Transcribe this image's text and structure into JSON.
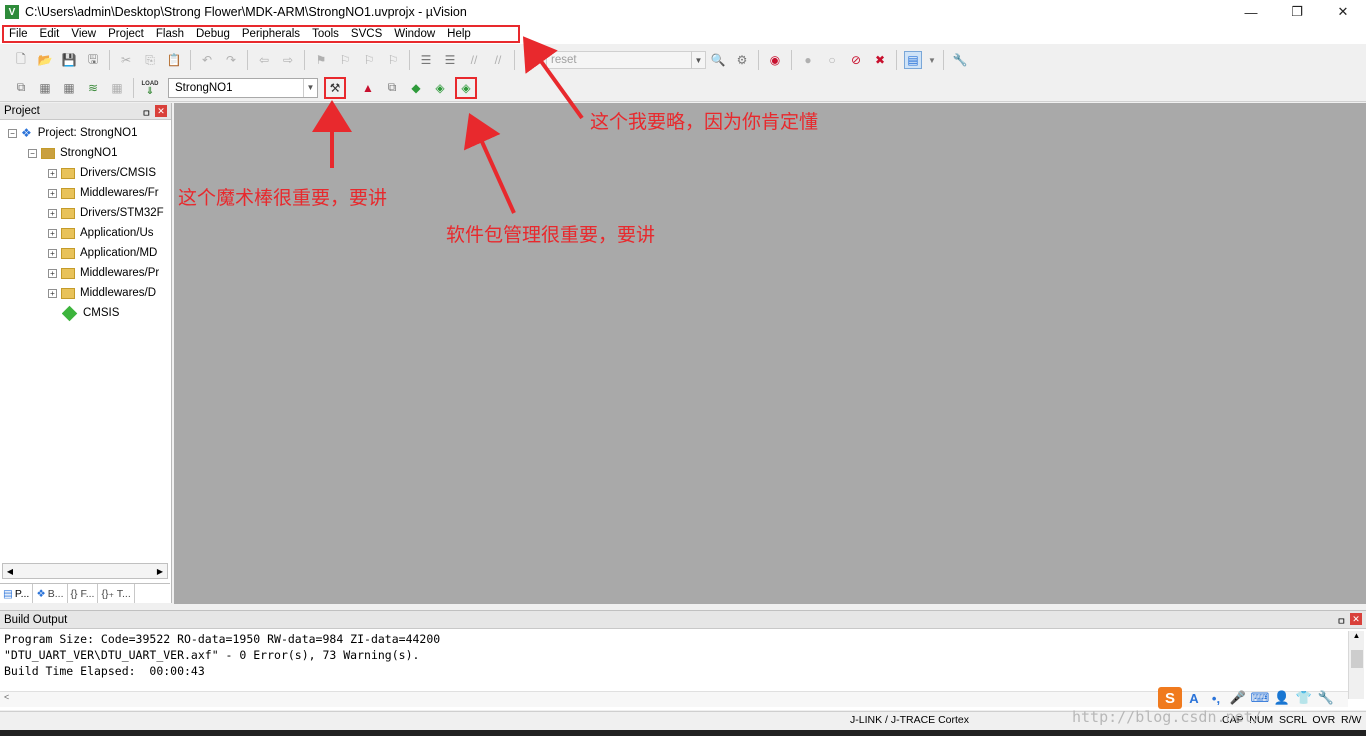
{
  "window": {
    "title": "C:\\Users\\admin\\Desktop\\Strong Flower\\MDK-ARM\\StrongNO1.uvprojx - µVision",
    "app_icon_glyph": "V",
    "minimize": "—",
    "maximize": "❐",
    "close": "✕"
  },
  "menu": [
    "File",
    "Edit",
    "View",
    "Project",
    "Flash",
    "Debug",
    "Peripherals",
    "Tools",
    "SVCS",
    "Window",
    "Help"
  ],
  "toolbar": {
    "find_combo_value": "reset",
    "target_combo_value": "StrongNO1",
    "load_label": "LOAD"
  },
  "project_panel": {
    "title": "Project",
    "pin": "ㅁ",
    "close": "✕",
    "tree": [
      {
        "label": "Project: StrongNO1",
        "kind": "root"
      },
      {
        "label": "StrongNO1",
        "kind": "target"
      },
      {
        "label": "Drivers/CMSIS",
        "kind": "folder"
      },
      {
        "label": "Middlewares/Fr",
        "kind": "folder"
      },
      {
        "label": "Drivers/STM32F",
        "kind": "folder"
      },
      {
        "label": "Application/Us",
        "kind": "folder"
      },
      {
        "label": "Application/MD",
        "kind": "folder"
      },
      {
        "label": "Middlewares/Pr",
        "kind": "folder"
      },
      {
        "label": "Middlewares/D",
        "kind": "folder"
      },
      {
        "label": "CMSIS",
        "kind": "component"
      }
    ],
    "tabs": [
      "P...",
      "B...",
      "{} F...",
      "{}₊ T..."
    ]
  },
  "build_output": {
    "title": "Build Output",
    "lines": [
      "Program Size: Code=39522 RO-data=1950 RW-data=984 ZI-data=44200",
      "\"DTU_UART_VER\\DTU_UART_VER.axf\" - 0 Error(s), 73 Warning(s).",
      "Build Time Elapsed:  00:00:43"
    ]
  },
  "statusbar": {
    "debugger": "J-LINK / J-TRACE Cortex",
    "indicators": "CAP  NUM  SCRL  OVR  R/W"
  },
  "watermark": "http://blog.csdn.net/",
  "annotations": {
    "menu_note": "这个我要略，因为你肯定懂",
    "wand_note": "这个魔术棒很重要，要讲",
    "pack_note": "软件包管理很重要，要讲"
  },
  "colors": {
    "annotation_red": "#e8292d",
    "editor_bg": "#a9a9a9"
  }
}
